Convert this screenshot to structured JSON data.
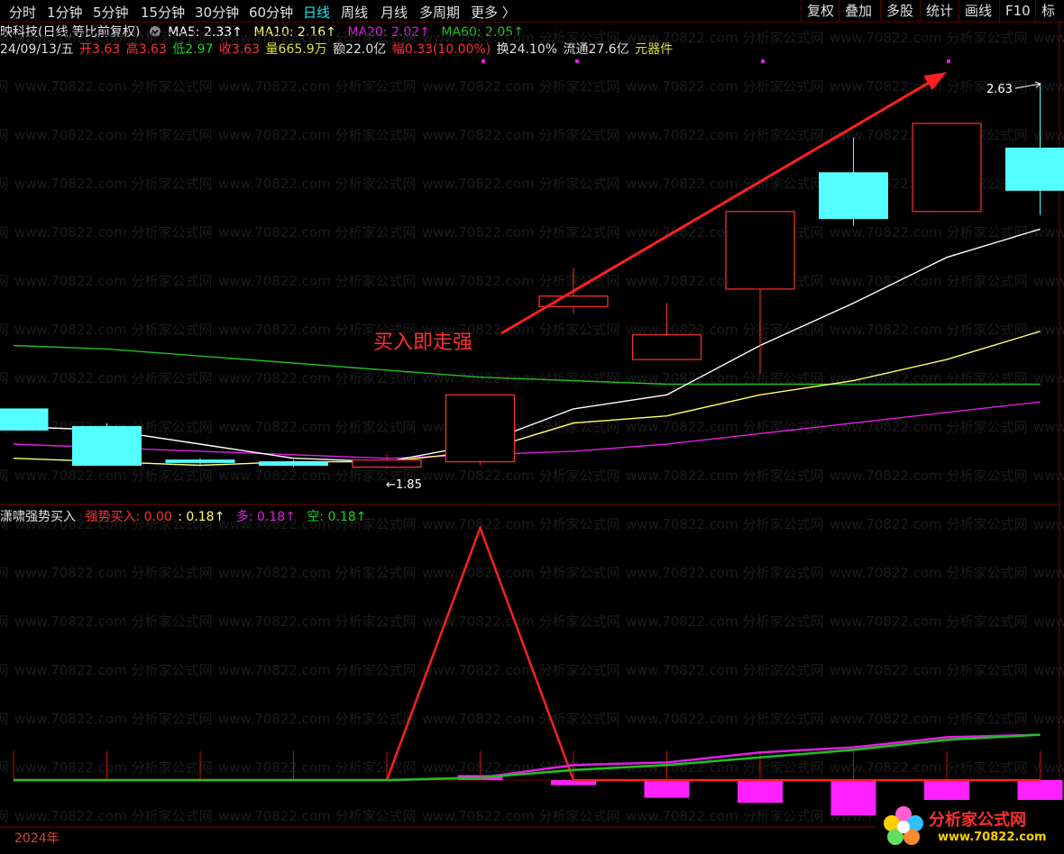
{
  "toolbar": {
    "periods": [
      "分时",
      "1分钟",
      "5分钟",
      "15分钟",
      "30分钟",
      "60分钟",
      "日线",
      "周线",
      "月线",
      "多周期",
      "更多 〉"
    ],
    "active_period": "日线",
    "right_buttons": [
      "复权",
      "叠加",
      "多股",
      "统计",
      "画线",
      "F10",
      "标"
    ]
  },
  "header": {
    "stock_title": "映科技(日线,等比前复权)",
    "ma5": "MA5: 2.33↑",
    "ma10": "MA10: 2.16↑",
    "ma20": "MA20: 2.02↑",
    "ma60": "MA60: 2.05↑",
    "date": "24/09/13/五",
    "open": "开3.63",
    "high": "高3.63",
    "low": "低2.97",
    "close": "收3.63",
    "volume": "量665.9万",
    "amount": "额22.0亿",
    "change": "幅0.33(10.00%)",
    "turnover": "换24.10%",
    "float_cap": "流通27.6亿",
    "sector": "元器件"
  },
  "indicator": {
    "name": "潇啸强势买入",
    "buy_label": "强势买入: 0.00",
    "value": ": 0.18↑",
    "duo": "多: 0.18↑",
    "kong": "空: 0.18↑"
  },
  "annotation": "买入即走强",
  "footer": {
    "year": "2024年"
  },
  "watermark": "www.70822.com 分析家公式网",
  "logo": {
    "name": "分析家公式网",
    "url": "www.70822.com"
  },
  "colors": {
    "up": "#ff3030",
    "down": "#54ffff",
    "ma5": "#ffffff",
    "ma10": "#ffff70",
    "ma20": "#e020e0",
    "ma60": "#20c020",
    "active": "#19e8e8"
  },
  "chart_data": {
    "type": "candlestick",
    "price_markers": {
      "low": "←1.85",
      "high": "2.63"
    },
    "candles": [
      {
        "open": 2.02,
        "close": 1.96,
        "high": 2.02,
        "low": 1.96
      },
      {
        "open": 1.97,
        "close": 1.86,
        "high": 1.98,
        "low": 1.86
      },
      {
        "open": 1.875,
        "close": 1.868,
        "high": 1.88,
        "low": 1.86
      },
      {
        "open": 1.87,
        "close": 1.86,
        "high": 1.875,
        "low": 1.855
      },
      {
        "open": 1.855,
        "close": 1.875,
        "high": 1.89,
        "low": 1.85
      },
      {
        "open": 1.87,
        "close": 2.06,
        "high": 2.06,
        "low": 1.86
      },
      {
        "open": 2.31,
        "close": 2.34,
        "high": 2.42,
        "low": 2.29
      },
      {
        "open": 2.16,
        "close": 2.23,
        "high": 2.32,
        "low": 2.16
      },
      {
        "open": 2.36,
        "close": 2.58,
        "high": 2.58,
        "low": 2.12
      },
      {
        "open": 2.69,
        "close": 2.56,
        "high": 2.79,
        "low": 2.54
      },
      {
        "open": 2.58,
        "close": 2.83,
        "high": 2.83,
        "low": 2.58
      },
      {
        "open": 2.76,
        "close": 2.64,
        "high": 2.94,
        "low": 2.57
      }
    ],
    "ma5": [
      1.97,
      1.96,
      1.92,
      1.88,
      1.87,
      1.92,
      2.02,
      2.06,
      2.2,
      2.32,
      2.45,
      2.53
    ],
    "ma10": [
      1.88,
      1.87,
      1.86,
      1.87,
      1.87,
      1.9,
      1.98,
      2.0,
      2.06,
      2.1,
      2.16,
      2.24
    ],
    "ma20": [
      1.92,
      1.91,
      1.9,
      1.89,
      1.88,
      1.89,
      1.9,
      1.92,
      1.95,
      1.98,
      2.01,
      2.04
    ],
    "ma60": [
      2.2,
      2.19,
      2.17,
      2.15,
      2.13,
      2.11,
      2.1,
      2.09,
      2.09,
      2.09,
      2.09,
      2.09
    ],
    "indicator_series": {
      "buy": [
        0,
        0,
        0,
        0,
        0,
        1.0,
        0,
        0,
        0,
        0,
        0,
        0
      ],
      "duo": [
        0,
        0,
        0,
        0,
        0,
        0.01,
        0.06,
        0.07,
        0.11,
        0.13,
        0.17,
        0.18
      ],
      "kong": [
        0,
        0,
        0,
        0,
        0,
        0.01,
        0.04,
        0.06,
        0.09,
        0.12,
        0.16,
        0.18
      ],
      "bars": [
        0,
        0,
        0,
        0,
        0,
        0.02,
        -0.02,
        -0.07,
        -0.09,
        -0.14,
        -0.11,
        -0.11
      ]
    }
  }
}
